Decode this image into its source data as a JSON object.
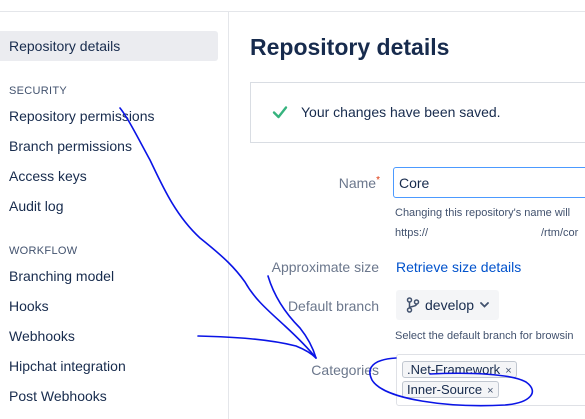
{
  "sidebar": {
    "active_item": "Repository details",
    "sections": [
      {
        "heading": "SECURITY",
        "items": [
          "Repository permissions",
          "Branch permissions",
          "Access keys",
          "Audit log"
        ]
      },
      {
        "heading": "WORKFLOW",
        "items": [
          "Branching model",
          "Hooks",
          "Webhooks",
          "Hipchat integration",
          "Post Webhooks"
        ]
      }
    ]
  },
  "main": {
    "title": "Repository details",
    "success_message": "Your changes have been saved.",
    "name_field": {
      "label": "Name",
      "required_mark": "*",
      "value": "Core",
      "help_line1": "Changing this repository's name will",
      "help_line2_start": "https://",
      "help_line2_end": "/rtm/cor"
    },
    "size": {
      "label": "Approximate size",
      "link": "Retrieve size details"
    },
    "default_branch": {
      "label": "Default branch",
      "value": "develop",
      "help": "Select the default branch for browsin"
    },
    "categories": {
      "label": "Categories",
      "tags": [
        ".Net-Framework",
        "Inner-Source"
      ],
      "remove_glyph": "×"
    }
  },
  "colors": {
    "success_check": "#36b37e",
    "link": "#0052cc",
    "annotation_ink": "#0a14e6"
  },
  "icons": [
    "check-icon",
    "branch-icon",
    "chevron-down-icon",
    "remove-tag-icon"
  ]
}
